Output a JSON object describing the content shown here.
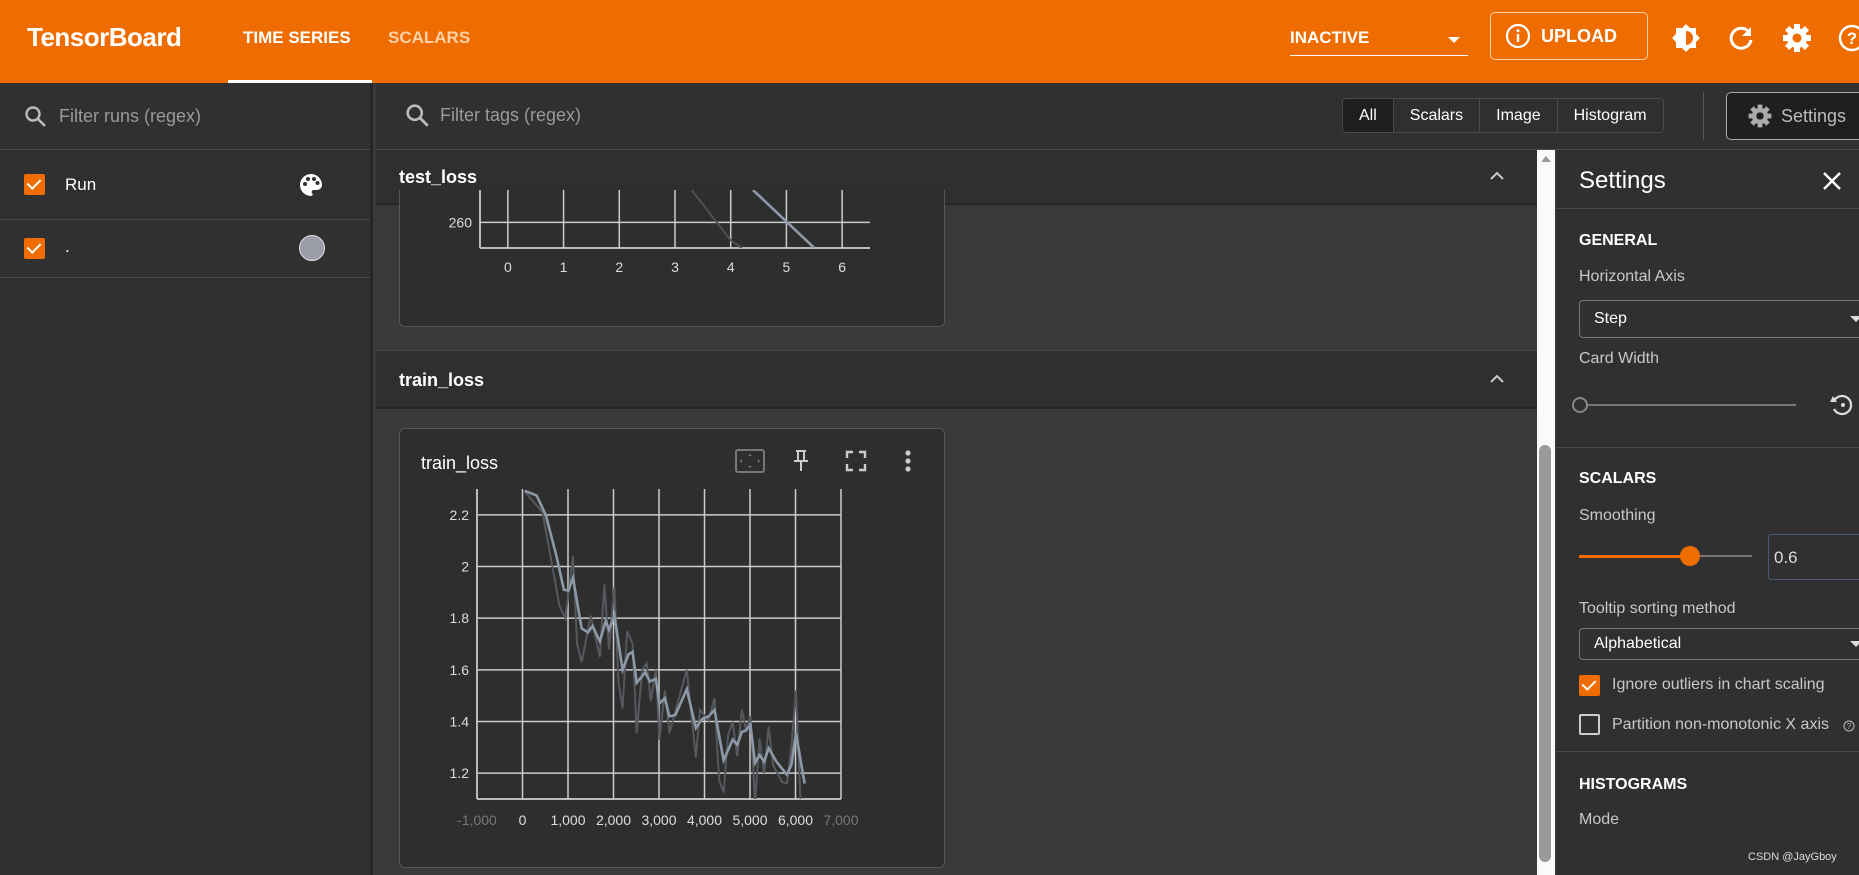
{
  "header": {
    "logo": "TensorBoard",
    "tabs": [
      {
        "label": "TIME SERIES",
        "active": true
      },
      {
        "label": "SCALARS",
        "active": false
      }
    ],
    "reload_status": "INACTIVE",
    "upload_label": "UPLOAD",
    "icons": [
      "brightness-icon",
      "refresh-icon",
      "gear-icon",
      "help-icon"
    ],
    "accent": "#ef6c00"
  },
  "sidebar": {
    "filter_placeholder": "Filter runs (regex)",
    "runs": [
      {
        "label": "Run",
        "checked": true,
        "icon": "palette-icon"
      },
      {
        "label": ".",
        "checked": true,
        "color": "#9aa0a6"
      }
    ]
  },
  "toolbar": {
    "filter_placeholder": "Filter tags (regex)",
    "types": [
      "All",
      "Scalars",
      "Image",
      "Histogram"
    ],
    "selected": "All",
    "settings_label": "Settings"
  },
  "sections": [
    {
      "title": "test_loss"
    },
    {
      "title": "train_loss",
      "card_title": "train_loss"
    }
  ],
  "settings": {
    "title": "Settings",
    "general": {
      "heading": "GENERAL",
      "horizontal_axis_label": "Horizontal Axis",
      "horizontal_axis_value": "Step",
      "card_width_label": "Card Width",
      "card_width_fraction": 0
    },
    "scalars": {
      "heading": "SCALARS",
      "smoothing_label": "Smoothing",
      "smoothing_value": "0.6",
      "tooltip_label": "Tooltip sorting method",
      "tooltip_value": "Alphabetical",
      "ignore_outliers_label": "Ignore outliers in chart scaling",
      "ignore_outliers": true,
      "partition_label": "Partition non-monotonic X axis",
      "partition": false
    },
    "histograms": {
      "heading": "HISTOGRAMS",
      "mode_label": "Mode"
    }
  },
  "watermark": "CSDN @JayGboy",
  "chart_data": [
    {
      "type": "line",
      "title": "test_loss",
      "xticks": [
        "0",
        "1",
        "2",
        "3",
        "4",
        "5",
        "6"
      ],
      "yticks": [
        "260"
      ],
      "xlim": [
        -0.5,
        6.5
      ],
      "ylim": [
        255,
        266.3
      ],
      "grid": true,
      "series": [
        {
          "role": "raw",
          "color": "#4e5257",
          "points": [
            [
              3.3,
              266.3
            ],
            [
              4.0,
              256.5
            ],
            [
              4.2,
              255
            ]
          ]
        },
        {
          "role": "smoothed",
          "color": "#8d99a6",
          "points": [
            [
              4.4,
              266.3
            ],
            [
              5.5,
              255
            ]
          ]
        }
      ]
    },
    {
      "type": "line",
      "title": "train_loss",
      "xticks": [
        "-1,000",
        "0",
        "1,000",
        "2,000",
        "3,000",
        "4,000",
        "5,000",
        "6,000",
        "7,000"
      ],
      "yticks": [
        "1.2",
        "1.4",
        "1.6",
        "1.8",
        "2",
        "2.2"
      ],
      "xlim": [
        -1000,
        7000
      ],
      "ylim": [
        1.1,
        2.3
      ],
      "grid": true,
      "series": [
        {
          "role": "raw",
          "color": "#55595e",
          "points": [
            [
              50,
              2.29
            ],
            [
              440,
              2.21
            ],
            [
              810,
              1.85
            ],
            [
              940,
              1.8
            ],
            [
              1110,
              2.04
            ],
            [
              1200,
              1.7
            ],
            [
              1300,
              1.63
            ],
            [
              1500,
              1.81
            ],
            [
              1700,
              1.65
            ],
            [
              1800,
              1.93
            ],
            [
              1900,
              1.68
            ],
            [
              2020,
              1.92
            ],
            [
              2110,
              1.55
            ],
            [
              2200,
              1.45
            ],
            [
              2300,
              1.75
            ],
            [
              2420,
              1.7
            ],
            [
              2510,
              1.355
            ],
            [
              2630,
              1.6
            ],
            [
              2730,
              1.625
            ],
            [
              2820,
              1.48
            ],
            [
              2930,
              1.6
            ],
            [
              3010,
              1.33
            ],
            [
              3130,
              1.52
            ],
            [
              3230,
              1.355
            ],
            [
              3360,
              1.44
            ],
            [
              3610,
              1.6
            ],
            [
              3810,
              1.26
            ],
            [
              3900,
              1.445
            ],
            [
              4090,
              1.405
            ],
            [
              4220,
              1.49
            ],
            [
              4320,
              1.175
            ],
            [
              4420,
              1.125
            ],
            [
              4520,
              1.35
            ],
            [
              4620,
              1.395
            ],
            [
              4720,
              1.265
            ],
            [
              4820,
              1.445
            ],
            [
              4910,
              1.37
            ],
            [
              5010,
              1.42
            ],
            [
              5110,
              1.09
            ],
            [
              5210,
              1.335
            ],
            [
              5310,
              1.2
            ],
            [
              5410,
              1.38
            ],
            [
              5510,
              1.23
            ],
            [
              5710,
              1.165
            ],
            [
              5810,
              1.16
            ],
            [
              5910,
              1.3
            ],
            [
              6010,
              1.52
            ],
            [
              6110,
              1.1
            ]
          ]
        },
        {
          "role": "smoothed",
          "color": "#8d99a6",
          "points": [
            [
              50,
              2.293
            ],
            [
              310,
              2.275
            ],
            [
              510,
              2.2
            ],
            [
              740,
              2.045
            ],
            [
              910,
              1.91
            ],
            [
              1010,
              1.907
            ],
            [
              1110,
              1.957
            ],
            [
              1300,
              1.76
            ],
            [
              1440,
              1.745
            ],
            [
              1540,
              1.77
            ],
            [
              1700,
              1.71
            ],
            [
              1830,
              1.79
            ],
            [
              1900,
              1.755
            ],
            [
              2020,
              1.81
            ],
            [
              2200,
              1.6
            ],
            [
              2330,
              1.66
            ],
            [
              2420,
              1.67
            ],
            [
              2510,
              1.55
            ],
            [
              2700,
              1.59
            ],
            [
              2800,
              1.555
            ],
            [
              2930,
              1.565
            ],
            [
              3010,
              1.47
            ],
            [
              3130,
              1.49
            ],
            [
              3230,
              1.42
            ],
            [
              3360,
              1.425
            ],
            [
              3610,
              1.525
            ],
            [
              3810,
              1.375
            ],
            [
              3950,
              1.41
            ],
            [
              4090,
              1.42
            ],
            [
              4220,
              1.445
            ],
            [
              4420,
              1.25
            ],
            [
              4620,
              1.33
            ],
            [
              4720,
              1.31
            ],
            [
              4820,
              1.36
            ],
            [
              4910,
              1.365
            ],
            [
              5010,
              1.387
            ],
            [
              5110,
              1.24
            ],
            [
              5210,
              1.27
            ],
            [
              5310,
              1.245
            ],
            [
              5410,
              1.297
            ],
            [
              5580,
              1.245
            ],
            [
              5810,
              1.194
            ],
            [
              5910,
              1.232
            ],
            [
              6010,
              1.355
            ],
            [
              6200,
              1.16
            ]
          ]
        }
      ]
    }
  ]
}
